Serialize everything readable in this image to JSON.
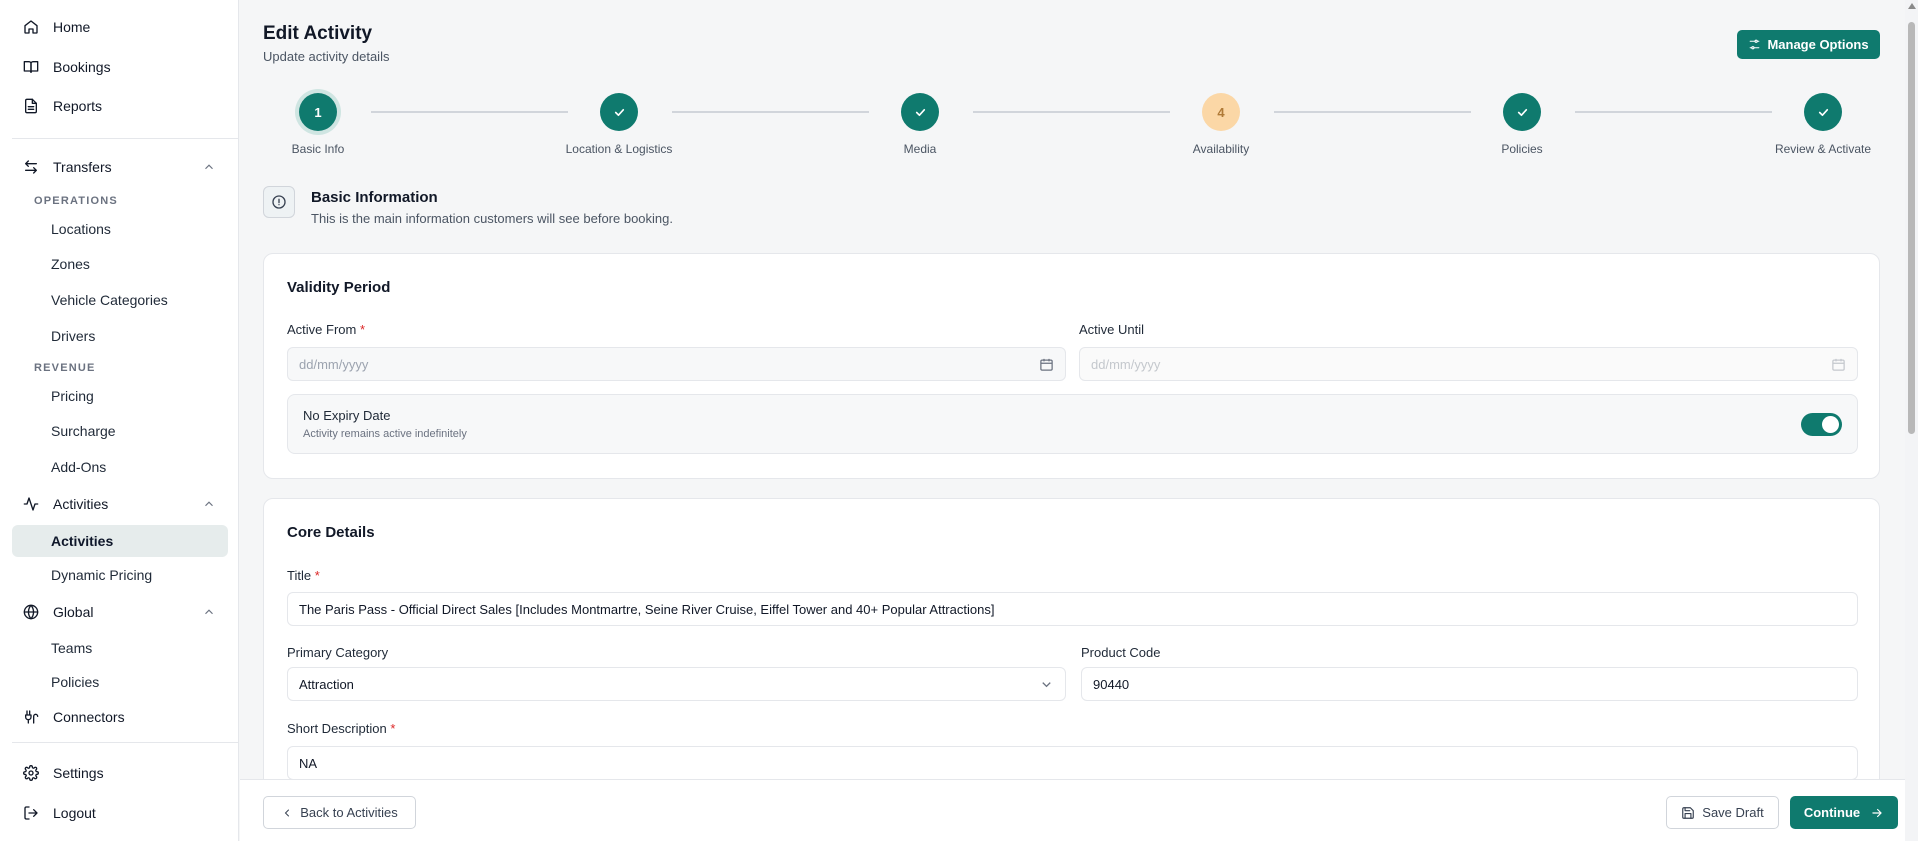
{
  "sidebar": {
    "home": "Home",
    "bookings": "Bookings",
    "reports": "Reports",
    "transfers": "Transfers",
    "operations_label": "OPERATIONS",
    "locations": "Locations",
    "zones": "Zones",
    "vehicle_categories": "Vehicle Categories",
    "drivers": "Drivers",
    "revenue_label": "REVENUE",
    "pricing": "Pricing",
    "surcharge": "Surcharge",
    "addons": "Add-Ons",
    "activities": "Activities",
    "activities_sub": "Activities",
    "dynamic_pricing": "Dynamic Pricing",
    "global": "Global",
    "teams": "Teams",
    "policies": "Policies",
    "connectors": "Connectors",
    "settings": "Settings",
    "logout": "Logout"
  },
  "header": {
    "title": "Edit Activity",
    "subtitle": "Update activity details",
    "manage_options": "Manage Options"
  },
  "stepper": {
    "steps": [
      {
        "label": "Basic Info",
        "state": "current",
        "number": "1"
      },
      {
        "label": "Location & Logistics",
        "state": "done"
      },
      {
        "label": "Media",
        "state": "done"
      },
      {
        "label": "Availability",
        "state": "pending",
        "number": "4"
      },
      {
        "label": "Policies",
        "state": "done"
      },
      {
        "label": "Review & Activate",
        "state": "done"
      }
    ]
  },
  "section": {
    "title": "Basic Information",
    "description": "This is the main information customers will see before booking."
  },
  "validity": {
    "title": "Validity Period",
    "active_from_label": "Active From",
    "active_from_placeholder": "dd/mm/yyyy",
    "active_until_label": "Active Until",
    "active_until_placeholder": "dd/mm/yyyy",
    "no_expiry_label": "No Expiry Date",
    "no_expiry_desc": "Activity remains active indefinitely",
    "no_expiry_enabled": true
  },
  "core": {
    "title": "Core Details",
    "title_label": "Title",
    "title_value": "The Paris Pass - Official Direct Sales [Includes Montmartre, Seine River Cruise, Eiffel Tower and 40+ Popular Attractions]",
    "category_label": "Primary Category",
    "category_value": "Attraction",
    "product_code_label": "Product Code",
    "product_code_value": "90440",
    "short_desc_label": "Short Description",
    "short_desc_value": "NA"
  },
  "footer": {
    "back": "Back to Activities",
    "save_draft": "Save Draft",
    "continue": "Continue"
  },
  "required_mark": "*",
  "colors": {
    "accent": "#0f7a6e",
    "pending_step": "#fbd7a6",
    "required": "#dc2626"
  }
}
